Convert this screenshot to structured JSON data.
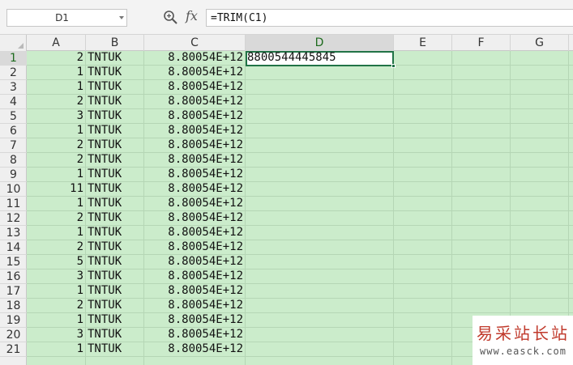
{
  "formula_bar": {
    "name_box": "D1",
    "fx_label": "fx",
    "formula": "=TRIM(C1)"
  },
  "sheet": {
    "active_cell": "D1",
    "columns": [
      "A",
      "B",
      "C",
      "D",
      "E",
      "F",
      "G"
    ],
    "rows": [
      {
        "num": "1",
        "a": "2",
        "b": "TNTUK",
        "c": "8.80054E+12",
        "d": "8800544445845"
      },
      {
        "num": "2",
        "a": "1",
        "b": "TNTUK",
        "c": "8.80054E+12",
        "d": ""
      },
      {
        "num": "3",
        "a": "1",
        "b": "TNTUK",
        "c": "8.80054E+12",
        "d": ""
      },
      {
        "num": "4",
        "a": "2",
        "b": "TNTUK",
        "c": "8.80054E+12",
        "d": ""
      },
      {
        "num": "5",
        "a": "3",
        "b": "TNTUK",
        "c": "8.80054E+12",
        "d": ""
      },
      {
        "num": "6",
        "a": "1",
        "b": "TNTUK",
        "c": "8.80054E+12",
        "d": ""
      },
      {
        "num": "7",
        "a": "2",
        "b": "TNTUK",
        "c": "8.80054E+12",
        "d": ""
      },
      {
        "num": "8",
        "a": "2",
        "b": "TNTUK",
        "c": "8.80054E+12",
        "d": ""
      },
      {
        "num": "9",
        "a": "1",
        "b": "TNTUK",
        "c": "8.80054E+12",
        "d": ""
      },
      {
        "num": "10",
        "a": "11",
        "b": "TNTUK",
        "c": "8.80054E+12",
        "d": ""
      },
      {
        "num": "11",
        "a": "1",
        "b": "TNTUK",
        "c": "8.80054E+12",
        "d": ""
      },
      {
        "num": "12",
        "a": "2",
        "b": "TNTUK",
        "c": "8.80054E+12",
        "d": ""
      },
      {
        "num": "13",
        "a": "1",
        "b": "TNTUK",
        "c": "8.80054E+12",
        "d": ""
      },
      {
        "num": "14",
        "a": "2",
        "b": "TNTUK",
        "c": "8.80054E+12",
        "d": ""
      },
      {
        "num": "15",
        "a": "5",
        "b": "TNTUK",
        "c": "8.80054E+12",
        "d": ""
      },
      {
        "num": "16",
        "a": "3",
        "b": "TNTUK",
        "c": "8.80054E+12",
        "d": ""
      },
      {
        "num": "17",
        "a": "1",
        "b": "TNTUK",
        "c": "8.80054E+12",
        "d": ""
      },
      {
        "num": "18",
        "a": "2",
        "b": "TNTUK",
        "c": "8.80054E+12",
        "d": ""
      },
      {
        "num": "19",
        "a": "1",
        "b": "TNTUK",
        "c": "8.80054E+12",
        "d": ""
      },
      {
        "num": "20",
        "a": "3",
        "b": "TNTUK",
        "c": "8.80054E+12",
        "d": ""
      },
      {
        "num": "21",
        "a": "1",
        "b": "TNTUK",
        "c": "8.80054E+12",
        "d": ""
      }
    ]
  },
  "watermark": {
    "title": "易采站长站",
    "url": "www.easck.com"
  },
  "colors": {
    "cell_background": "#cbeccb",
    "gridline": "#b5d6b5",
    "active_border": "#217346",
    "watermark_red": "#c0392b"
  }
}
